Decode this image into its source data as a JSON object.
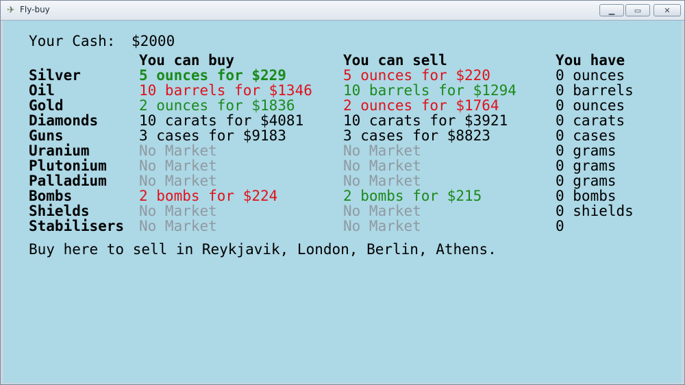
{
  "window": {
    "title": "Fly-buy",
    "icon": "app-icon"
  },
  "cash": {
    "label": "Your Cash:",
    "value": "$2000"
  },
  "headers": {
    "buy": "You can buy",
    "sell": "You can sell",
    "have": "You have"
  },
  "colors": {
    "background": "#add8e6",
    "profit": "#1a8a1a",
    "loss": "#e0111a",
    "neutral": "#000000",
    "no_market": "#8f9aa1"
  },
  "rows": [
    {
      "item": "Silver",
      "buy": "5 ounces for $229",
      "buy_color": "green",
      "buy_bold": true,
      "sell": "5 ounces for $220",
      "sell_color": "red",
      "have": "0 ounces"
    },
    {
      "item": "Oil",
      "buy": "10 barrels for $1346",
      "buy_color": "red",
      "buy_bold": false,
      "sell": "10 barrels for $1294",
      "sell_color": "green",
      "have": "0 barrels"
    },
    {
      "item": "Gold",
      "buy": "2 ounces for $1836",
      "buy_color": "green",
      "buy_bold": false,
      "sell": "2 ounces for $1764",
      "sell_color": "red",
      "have": "0 ounces"
    },
    {
      "item": "Diamonds",
      "buy": "10 carats for $4081",
      "buy_color": "black",
      "buy_bold": false,
      "sell": "10 carats for $3921",
      "sell_color": "black",
      "have": "0 carats"
    },
    {
      "item": "Guns",
      "buy": "3 cases for $9183",
      "buy_color": "black",
      "buy_bold": false,
      "sell": "3 cases for $8823",
      "sell_color": "black",
      "have": "0 cases"
    },
    {
      "item": "Uranium",
      "buy": "No Market",
      "buy_color": "gray",
      "buy_bold": false,
      "sell": "No Market",
      "sell_color": "gray",
      "have": "0 grams"
    },
    {
      "item": "Plutonium",
      "buy": "No Market",
      "buy_color": "gray",
      "buy_bold": false,
      "sell": "No Market",
      "sell_color": "gray",
      "have": "0 grams"
    },
    {
      "item": "Palladium",
      "buy": "No Market",
      "buy_color": "gray",
      "buy_bold": false,
      "sell": "No Market",
      "sell_color": "gray",
      "have": "0 grams"
    },
    {
      "item": "Bombs",
      "buy": "2 bombs for $224",
      "buy_color": "red",
      "buy_bold": false,
      "sell": "2 bombs for $215",
      "sell_color": "green",
      "have": "0 bombs"
    },
    {
      "item": "Shields",
      "buy": "No Market",
      "buy_color": "gray",
      "buy_bold": false,
      "sell": "No Market",
      "sell_color": "gray",
      "have": "0 shields"
    },
    {
      "item": "Stabilisers",
      "buy": "No Market",
      "buy_color": "gray",
      "buy_bold": false,
      "sell": "No Market",
      "sell_color": "gray",
      "have": "0"
    }
  ],
  "footer": "Buy here to sell in Reykjavik, London, Berlin, Athens."
}
